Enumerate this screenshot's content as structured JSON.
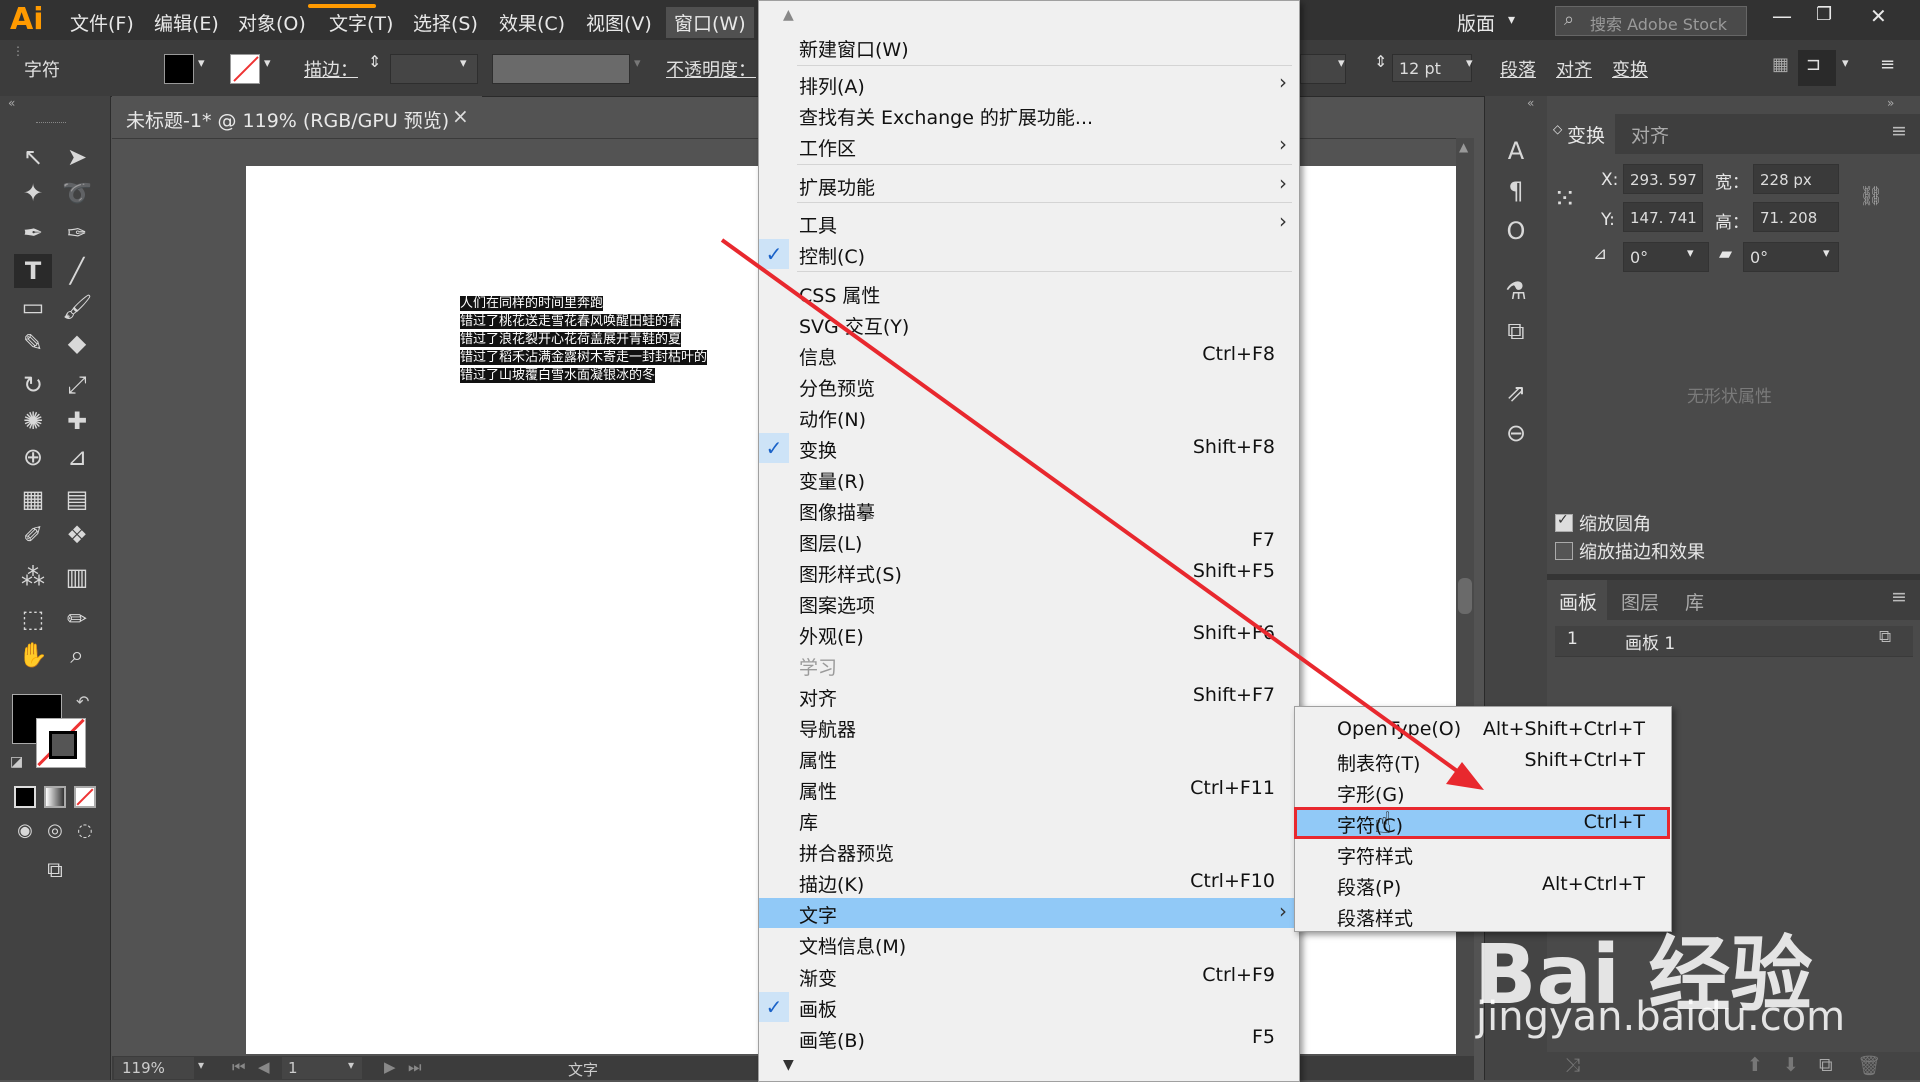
{
  "menubar": {
    "logo": "Ai",
    "items": [
      "文件(F)",
      "编辑(E)",
      "对象(O)",
      "文字(T)",
      "选择(S)",
      "效果(C)",
      "视图(V)",
      "窗口(W)"
    ],
    "workspace": "版面",
    "search_placeholder": "搜索 Adobe Stock"
  },
  "controlbar": {
    "label": "字符",
    "stroke_label": "描边：",
    "opacity_label": "不透明度：",
    "font_size": "12 pt",
    "paragraph": "段落",
    "align": "对齐",
    "transform": "变换"
  },
  "document": {
    "tab_title": "未标题-1* @ 119% (RGB/GPU 预览)",
    "close": "×",
    "text_lines": [
      "人们在同样的时间里奔跑",
      "错过了桃花送走雪花春风唤醒田蛙的春",
      "错过了浪花裂开心花荷盖展开青鞋的夏",
      "错过了稻禾沾满金露树木寄走一封封枯叶的",
      "错过了山坡覆白雪水面凝银冰的冬"
    ]
  },
  "statusbar": {
    "zoom": "119%",
    "page": "1",
    "tool": "文字"
  },
  "main_menu": {
    "items": [
      {
        "label": "新建窗口(W)"
      },
      {
        "label": "排列(A)",
        "arrow": "›"
      },
      {
        "label": "查找有关 Exchange 的扩展功能..."
      },
      {
        "label": "工作区",
        "arrow": "›"
      },
      {
        "label": "扩展功能",
        "arrow": "›"
      },
      {
        "label": "工具",
        "arrow": "›"
      },
      {
        "label": "控制(C)",
        "checked": true
      },
      {
        "label": "CSS 属性"
      },
      {
        "label": "SVG 交互(Y)"
      },
      {
        "label": "信息",
        "shortcut": "Ctrl+F8"
      },
      {
        "label": "分色预览"
      },
      {
        "label": "动作(N)"
      },
      {
        "label": "变换",
        "shortcut": "Shift+F8",
        "checked": true
      },
      {
        "label": "变量(R)"
      },
      {
        "label": "图像描摹"
      },
      {
        "label": "图层(L)",
        "shortcut": "F7"
      },
      {
        "label": "图形样式(S)",
        "shortcut": "Shift+F5"
      },
      {
        "label": "图案选项"
      },
      {
        "label": "外观(E)",
        "shortcut": "Shift+F6"
      },
      {
        "label": "学习",
        "disabled": true
      },
      {
        "label": "对齐",
        "shortcut": "Shift+F7"
      },
      {
        "label": "导航器"
      },
      {
        "label": "属性"
      },
      {
        "label": "属性",
        "shortcut": "Ctrl+F11"
      },
      {
        "label": "库"
      },
      {
        "label": "拼合器预览"
      },
      {
        "label": "描边(K)",
        "shortcut": "Ctrl+F10"
      },
      {
        "label": "文字",
        "arrow": "›",
        "highlight": true
      },
      {
        "label": "文档信息(M)"
      },
      {
        "label": "渐变",
        "shortcut": "Ctrl+F9"
      },
      {
        "label": "画板",
        "checked": true
      },
      {
        "label": "画笔(B)",
        "shortcut": "F5"
      }
    ]
  },
  "sub_menu": {
    "items": [
      {
        "label": "OpenType(O)",
        "shortcut": "Alt+Shift+Ctrl+T"
      },
      {
        "label": "制表符(T)",
        "shortcut": "Shift+Ctrl+T"
      },
      {
        "label": "字形(G)"
      },
      {
        "label": "字符(C)",
        "shortcut": "Ctrl+T",
        "highlight": true
      },
      {
        "label": "字符样式"
      },
      {
        "label": "段落(P)",
        "shortcut": "Alt+Ctrl+T"
      },
      {
        "label": "段落样式"
      }
    ]
  },
  "transform_panel": {
    "tab_transform": "变换",
    "tab_align": "对齐",
    "x_label": "X:",
    "x_value": "293. 597 p",
    "y_label": "Y:",
    "y_value": "147. 741 p",
    "w_label": "宽：",
    "w_value": "228 px",
    "h_label": "高：",
    "h_value": "71. 208 px",
    "angle_value": "0°",
    "shear_value": "0°",
    "no_shape": "无形状属性",
    "scale_corners": "缩放圆角",
    "scale_stroke": "缩放描边和效果"
  },
  "artboards_panel": {
    "tab_artboard": "画板",
    "tab_layers": "图层",
    "tab_library": "库",
    "row_index": "1",
    "row_name": "画板 1"
  },
  "watermark": {
    "line1": "Bai 经验",
    "line2": "jingyan.baidu.com"
  },
  "colors": {
    "accent": "#91c9f7",
    "annotation": "#e8282e"
  }
}
